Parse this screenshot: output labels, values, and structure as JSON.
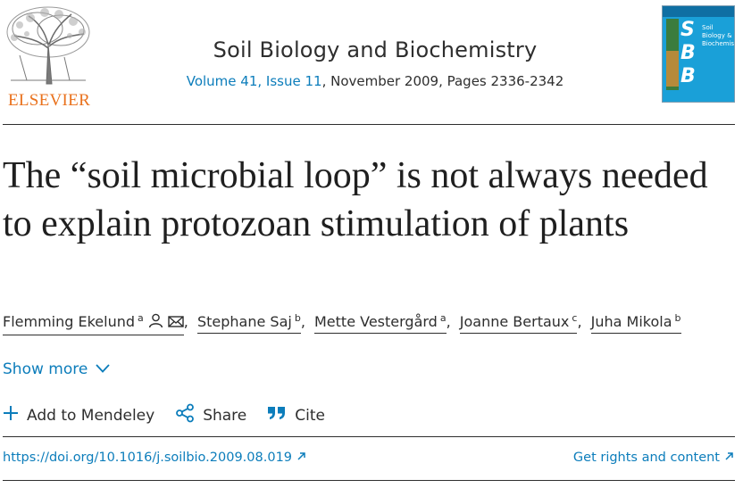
{
  "publisher": {
    "name": "ELSEVIER",
    "logo_icon": "elsevier-tree-logo",
    "accent": "#e9711c"
  },
  "journal": {
    "title": "Soil Biology and Biochemistry",
    "volume_issue": "Volume 41, Issue 11",
    "date_pages": ", November 2009, Pages 2336-2342",
    "cover": {
      "letters": "S\nB\nB",
      "title": "Soil Biology & Biochemistry"
    }
  },
  "article": {
    "title": "The “soil microbial loop” is not always needed to explain protozoan stimulation of plants"
  },
  "authors": [
    {
      "name": "Flemming Ekelund",
      "sup": "a"
    },
    {
      "name": "Stephane Saj",
      "sup": "b"
    },
    {
      "name": "Mette Vestergård",
      "sup": "a"
    },
    {
      "name": "Joanne Bertaux",
      "sup": "c"
    },
    {
      "name": "Juha Mikola",
      "sup": "b"
    }
  ],
  "author_separator": ",",
  "show_more": "Show more",
  "actions": {
    "mendeley": "Add to Mendeley",
    "share": "Share",
    "cite": "Cite"
  },
  "doi": "https://doi.org/10.1016/j.soilbio.2009.08.019",
  "rights": "Get rights and content",
  "colors": {
    "link": "#0c7dbb",
    "text": "#2e2e2e",
    "cover": "#1aa0d8"
  }
}
